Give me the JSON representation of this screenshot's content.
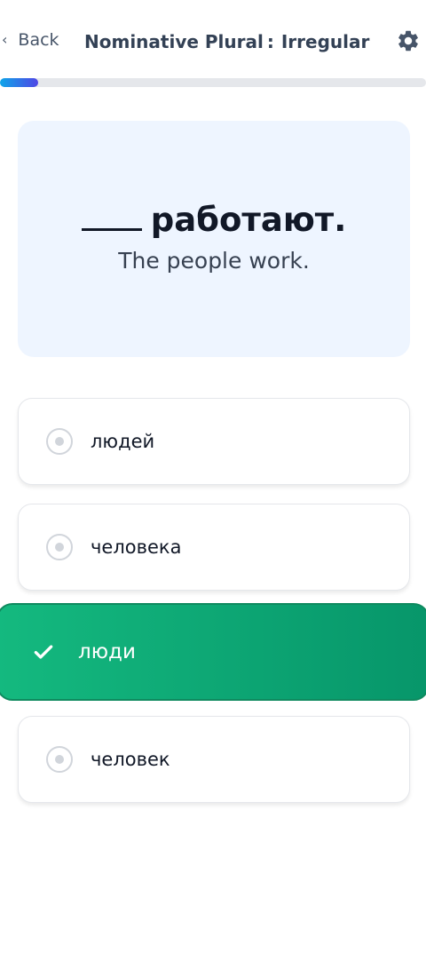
{
  "header": {
    "back_label": "Back",
    "title_part1": "Nominative Plural",
    "title_separator": ":",
    "title_part2": "Irregular",
    "back_icon": "chevron-left-icon",
    "settings_icon": "gear-icon"
  },
  "progress": {
    "fraction": 0.09
  },
  "prompt": {
    "sentence_rest": "работают.",
    "translation": "The people work."
  },
  "options": [
    {
      "label": "людей",
      "state": "unselected"
    },
    {
      "label": "человека",
      "state": "unselected"
    },
    {
      "label": "люди",
      "state": "correct"
    },
    {
      "label": "человек",
      "state": "unselected"
    }
  ],
  "colors": {
    "accent_gradient_start": "#0ea5e9",
    "accent_gradient_end": "#4f46e5",
    "correct_green": "#10a878",
    "prompt_background": "#eef5ff"
  }
}
